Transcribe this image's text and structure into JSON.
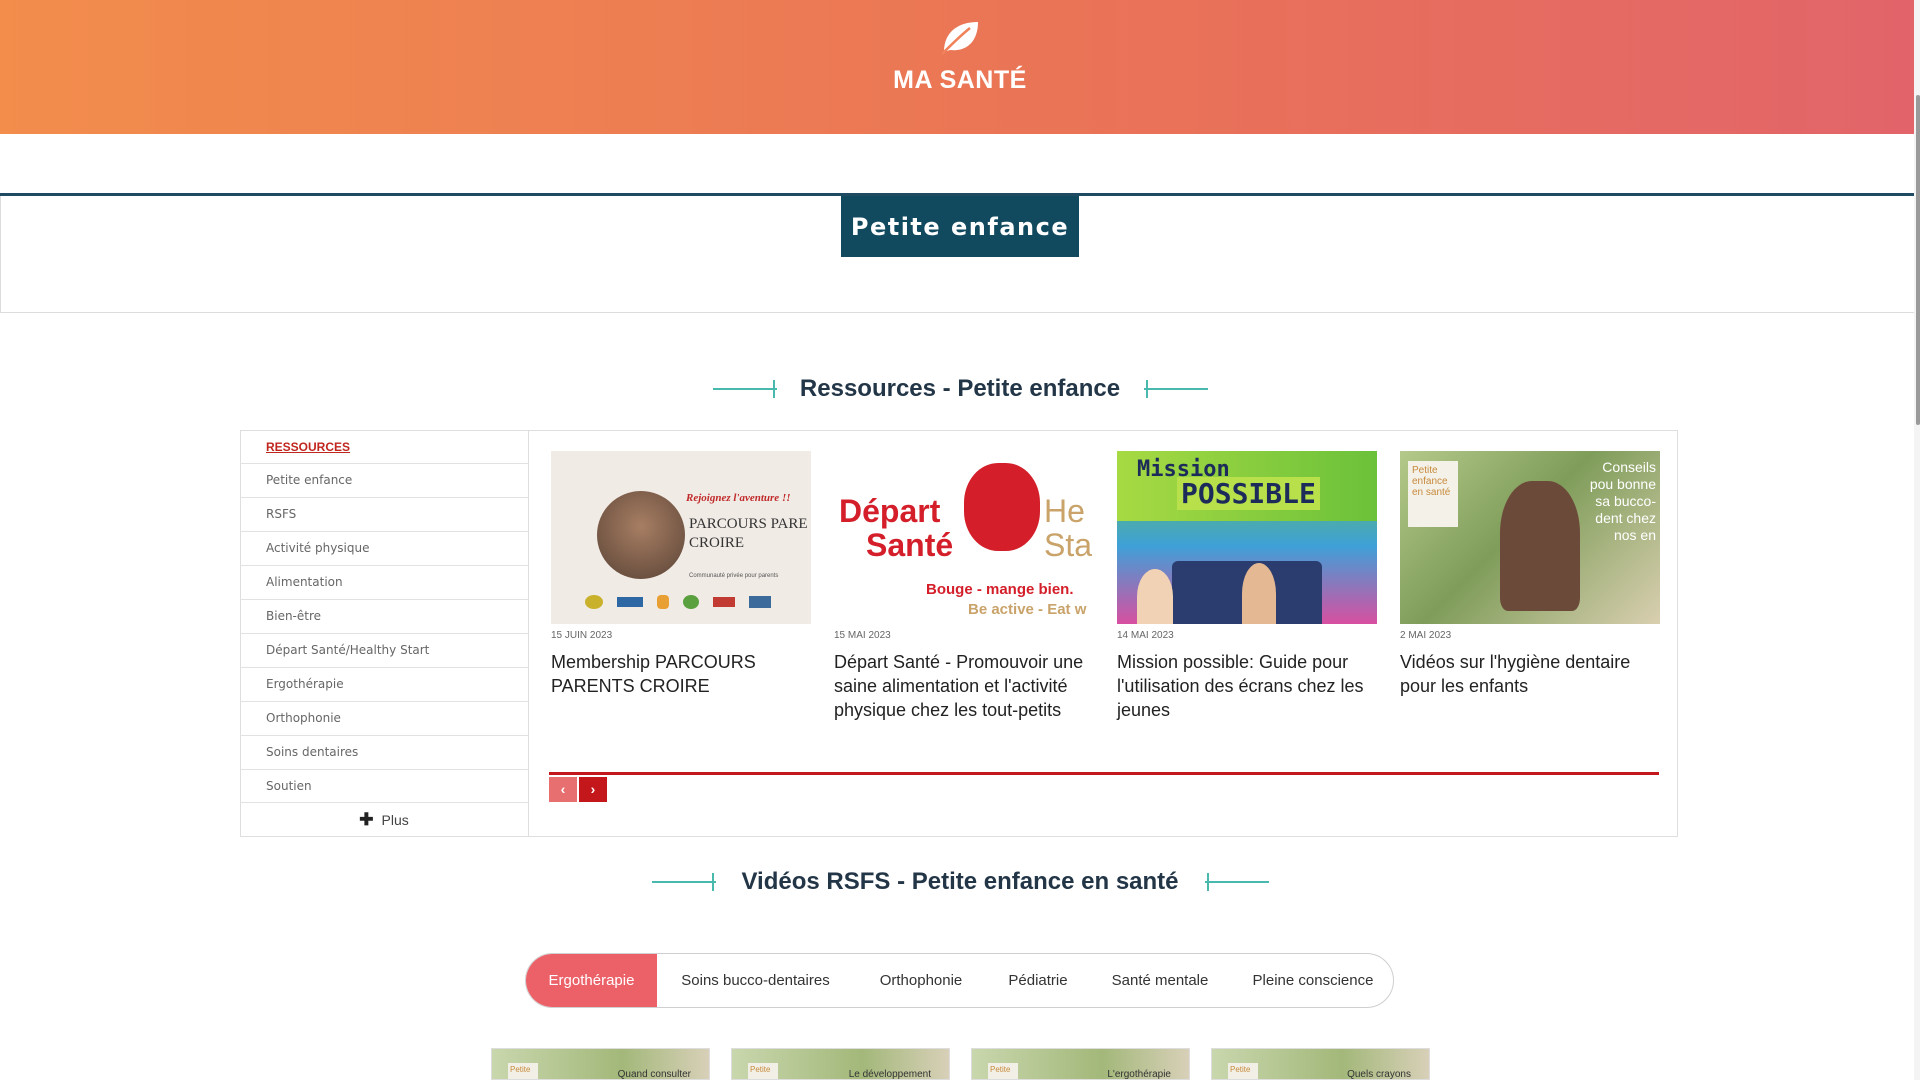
{
  "header": {
    "brand": "MA SANTÉ",
    "icon": "leaf-icon"
  },
  "category": {
    "title": "Petite enfance"
  },
  "resources_section": {
    "heading": "Ressources - Petite enfance",
    "sidebar": {
      "head": "RESSOURCES",
      "items": [
        "Petite enfance",
        "RSFS",
        "Activité physique",
        "Alimentation",
        "Bien-être",
        "Départ Santé/Healthy Start",
        "Ergothérapie",
        "Orthophonie",
        "Soins dentaires",
        "Soutien"
      ],
      "more": "Plus"
    },
    "cards": [
      {
        "date": "15 JUIN 2023",
        "title": "Membership PARCOURS PARENTS CROIRE",
        "thumb_texts": {
          "tagline": "Rejoignez l'aventure !!",
          "name1": "PARCOURS PARE",
          "name2": "CROIRE",
          "sub": "Communauté privée pour parents"
        }
      },
      {
        "date": "15 MAI 2023",
        "title": "Départ Santé - Promouvoir une saine alimentation et l'activité physique chez les tout-petits",
        "thumb_texts": {
          "w1": "Départ",
          "w2": "Santé",
          "w3": "He",
          "w4": "Sta",
          "slogan1": "Bouge - mange bien.",
          "slogan2": "Be active - Eat w"
        }
      },
      {
        "date": "14 MAI 2023",
        "title": "Mission possible: Guide pour l'utilisation des écrans chez les jeunes",
        "thumb_texts": {
          "w1": "Mission",
          "w2": "POSSIBLE"
        }
      },
      {
        "date": "2 MAI 2023",
        "title": "Vidéos sur l'hygiène dentaire pour les enfants",
        "thumb_texts": {
          "logo": "Petite enfance en santé",
          "caption": "Conseils pou bonne sa bucco­dent chez nos en"
        }
      }
    ]
  },
  "videos_section": {
    "heading": "Vidéos RSFS - Petite enfance en santé",
    "tabs": [
      "Ergothérapie",
      "Soins bucco-dentaires",
      "Orthophonie",
      "Pédiatrie",
      "Santé mentale",
      "Pleine conscience"
    ],
    "active_tab": "Ergothérapie",
    "thumbs": [
      "Quand consulter",
      "Le développement",
      "L'ergothérapie",
      "Quels crayons"
    ],
    "thumb_logo": "Petite"
  },
  "colors": {
    "accent": "#ec6068",
    "navy": "#114a5f",
    "red": "#c4171b",
    "teal": "#4ab9ad"
  }
}
